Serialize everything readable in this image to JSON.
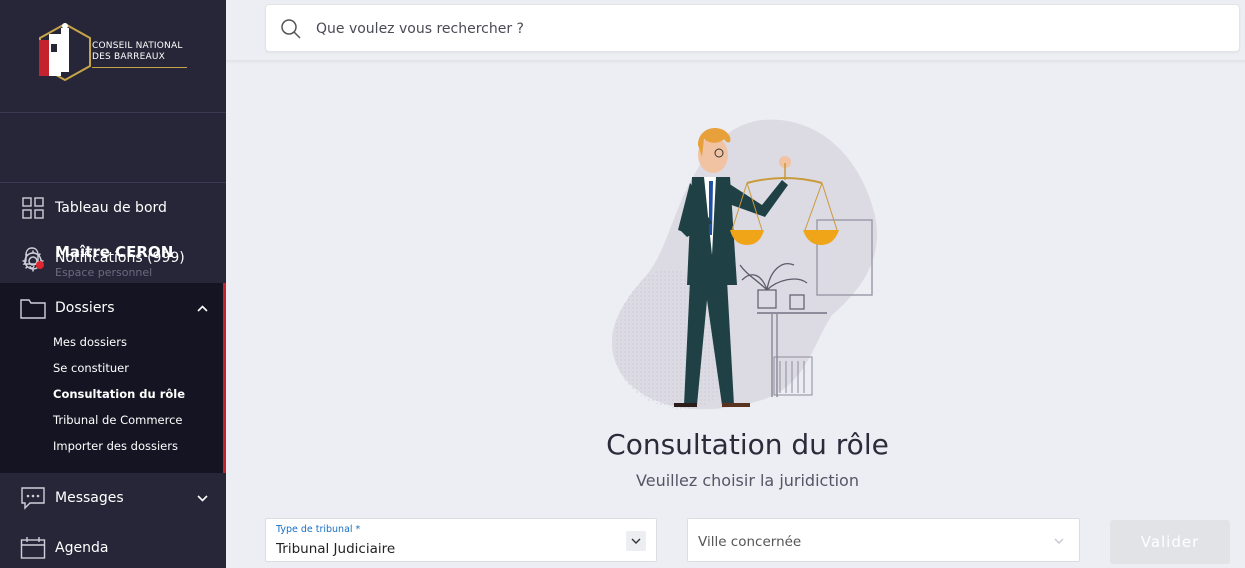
{
  "brand": {
    "line1": "CONSEIL NATIONAL",
    "line2": "DES BARREAUX"
  },
  "profile": {
    "name": "Maître CERON",
    "subtitle": "Espace personnel"
  },
  "nav": {
    "dashboard": "Tableau de bord",
    "notifications": "Notifications (999)",
    "dossiers": "Dossiers",
    "dossiers_items": [
      "Mes dossiers",
      "Se constituer",
      "Consultation du rôle",
      "Tribunal de Commerce",
      "Importer des dossiers"
    ],
    "messages": "Messages",
    "agenda": "Agenda"
  },
  "search": {
    "placeholder": "Que voulez vous rechercher ?"
  },
  "main": {
    "title": "Consultation du rôle",
    "subtitle": "Veuillez choisir la juridiction",
    "tribunal_label": "Type de tribunal *",
    "tribunal_value": "Tribunal Judiciaire",
    "ville_placeholder": "Ville concernée",
    "submit": "Valider"
  },
  "colors": {
    "sidebar": "#262638",
    "accent_red": "#c4222c",
    "label_blue": "#1a6fc4",
    "gold": "#c7a44a"
  }
}
